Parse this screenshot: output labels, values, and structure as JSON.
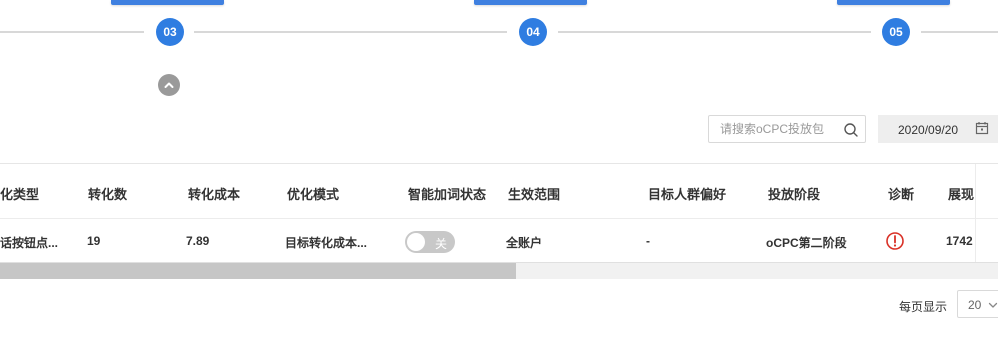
{
  "stepper": {
    "steps": [
      {
        "label": "03"
      },
      {
        "label": "04"
      },
      {
        "label": "05"
      }
    ]
  },
  "toolbar": {
    "search_placeholder": "请搜索oCPC投放包",
    "date_value": "2020/09/20"
  },
  "table": {
    "headers": [
      "化类型",
      "转化数",
      "转化成本",
      "优化模式",
      "智能加词状态",
      "生效范围",
      "目标人群偏好",
      "投放阶段",
      "诊断",
      "展现"
    ],
    "rows": [
      {
        "conv_type": "话按钮点...",
        "conv_count": "19",
        "conv_cost": "7.89",
        "opt_mode": "目标转化成本...",
        "smart_words_toggle": "关",
        "scope": "全账户",
        "audience_pref": "-",
        "stage": "oCPC第二阶段",
        "impressions": "1742"
      }
    ]
  },
  "pagination": {
    "per_page_label": "每页显示",
    "per_page_value": "20"
  },
  "colors": {
    "accent": "#2f7de1",
    "warning": "#d93026",
    "toggle_off": "#c8c8c8"
  },
  "icons": [
    "chevron-up-icon",
    "search-icon",
    "calendar-icon",
    "warning-circle-icon",
    "chevron-down-icon"
  ]
}
